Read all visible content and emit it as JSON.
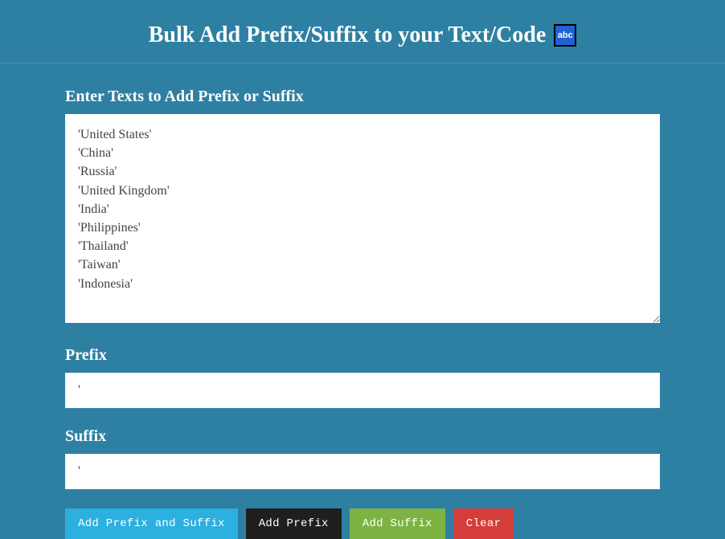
{
  "header": {
    "title": "Bulk Add Prefix/Suffix to your Text/Code",
    "icon_label": "abc"
  },
  "main": {
    "textarea": {
      "label": "Enter Texts to Add Prefix or Suffix",
      "value": "'United States'\n'China'\n'Russia'\n'United Kingdom'\n'India'\n'Philippines'\n'Thailand'\n'Taiwan'\n'Indonesia'"
    },
    "prefix": {
      "label": "Prefix",
      "value": "'"
    },
    "suffix": {
      "label": "Suffix",
      "value": "'"
    }
  },
  "buttons": {
    "add_both": "Add Prefix and Suffix",
    "add_prefix": "Add Prefix",
    "add_suffix": "Add Suffix",
    "clear": "Clear"
  }
}
